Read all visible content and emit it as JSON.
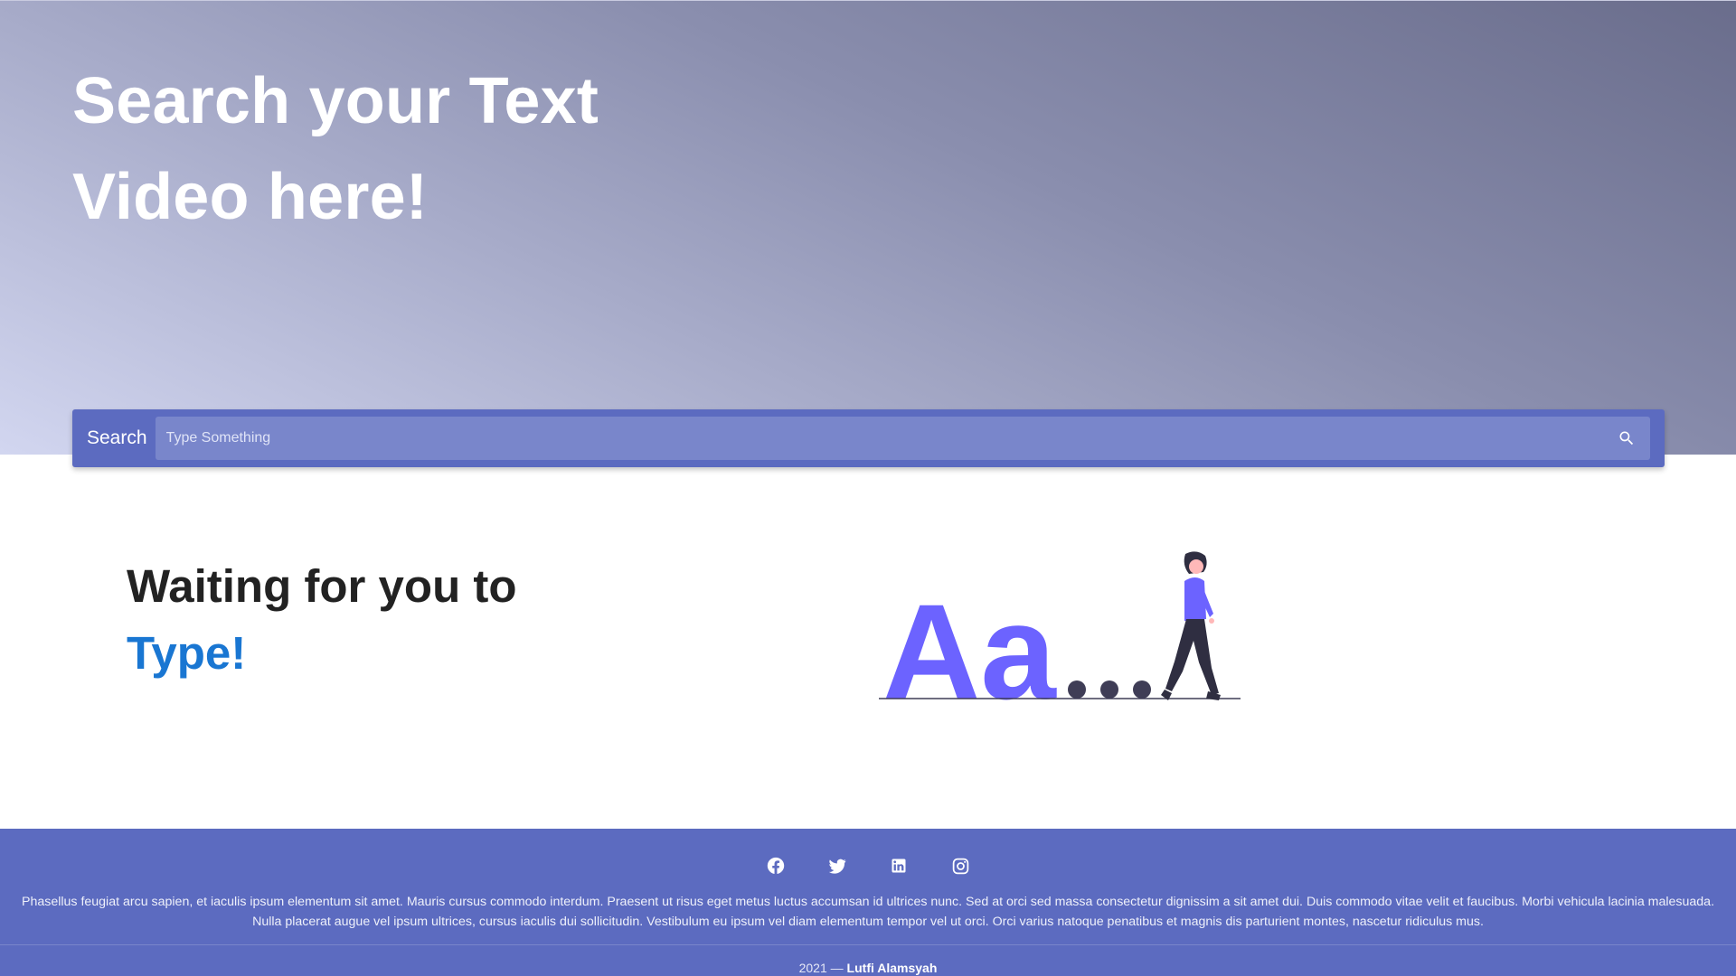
{
  "hero": {
    "title_line1": "Search your Text",
    "title_line2": "Video here!"
  },
  "search": {
    "label": "Search",
    "placeholder": "Type Something",
    "value": "",
    "icon": "search-icon"
  },
  "empty_state": {
    "line1": "Waiting for you to",
    "line2": "Type!",
    "illustration_text": "Aa"
  },
  "footer": {
    "social": [
      {
        "name": "facebook",
        "icon": "facebook-icon"
      },
      {
        "name": "twitter",
        "icon": "twitter-icon"
      },
      {
        "name": "linkedin",
        "icon": "linkedin-icon"
      },
      {
        "name": "instagram",
        "icon": "instagram-icon"
      }
    ],
    "paragraph_line1": "Phasellus feugiat arcu sapien, et iaculis ipsum elementum sit amet. Mauris cursus commodo interdum. Praesent ut risus eget metus luctus accumsan id ultrices nunc. Sed at orci sed massa consectetur dignissim a sit amet dui. Duis commodo vitae velit et faucibus. Morbi vehicula lacinia malesuada.",
    "paragraph_line2": "Nulla placerat augue vel ipsum ultrices, cursus iaculis dui sollicitudin. Vestibulum eu ipsum vel diam elementum tempor vel ut orci. Orci varius natoque penatibus et magnis dis parturient montes, nascetur ridiculus mus.",
    "copyright_prefix": "2021 — ",
    "author": "Lutfi Alamsyah"
  },
  "colors": {
    "primary": "#5c6bc0",
    "primary_light": "#7986cb",
    "accent": "#1976d2",
    "illustration": "#6c63ff",
    "dark": "#3f3d56"
  }
}
